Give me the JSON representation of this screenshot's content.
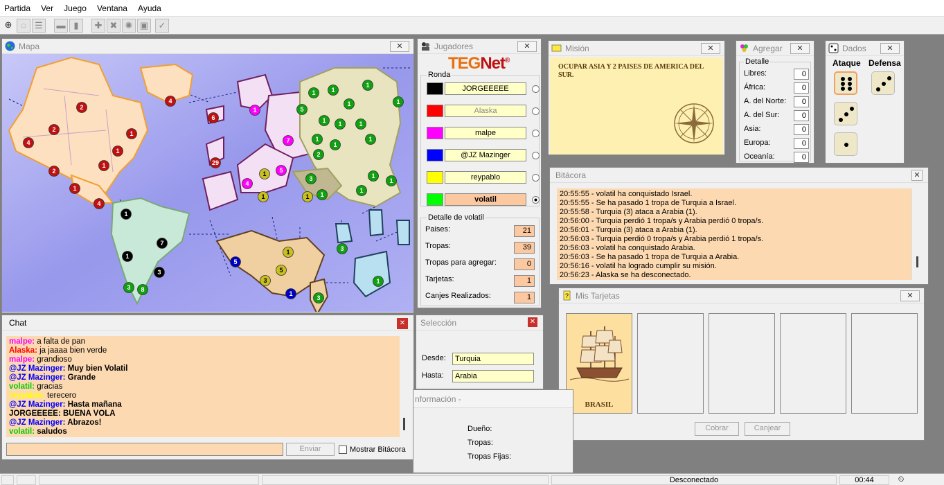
{
  "menu": [
    "Partida",
    "Ver",
    "Juego",
    "Ventana",
    "Ayuda"
  ],
  "map_window": {
    "title": "Mapa"
  },
  "map_armies": [
    {
      "c": "#ffffff",
      "n": "2"
    },
    {
      "c": "#ffffff",
      "n": "2"
    },
    {
      "c": "#ffffff",
      "n": "4"
    },
    {
      "c": "#ffffff",
      "n": "1"
    },
    {
      "c": "#ffffff",
      "n": "4"
    },
    {
      "c": "#ffffff",
      "n": "2"
    },
    {
      "c": "#ffffff",
      "n": "1"
    },
    {
      "c": "#ffffff",
      "n": "1"
    },
    {
      "c": "#ffffff",
      "n": "1"
    },
    {
      "c": "#ffffff",
      "n": "4"
    },
    {
      "c": "#ffffff",
      "n": "6"
    },
    {
      "c": "#ffffff",
      "n": "29"
    },
    {
      "c": "#ffffff",
      "n": "1"
    },
    {
      "c": "#ffffff",
      "n": "7"
    },
    {
      "c": "#ffffff",
      "n": "5"
    },
    {
      "c": "#ffffff",
      "n": "4"
    },
    {
      "c": "#ffffff",
      "n": "1"
    },
    {
      "c": "#ffffff",
      "n": "1"
    },
    {
      "c": "#ffffff",
      "n": "1"
    },
    {
      "c": "#ffffff",
      "n": "1"
    },
    {
      "c": "#ffffff",
      "n": "1"
    },
    {
      "c": "#ffffff",
      "n": "1"
    },
    {
      "c": "#ffffff",
      "n": "1"
    },
    {
      "c": "#ffffff",
      "n": "5"
    },
    {
      "c": "#ffffff",
      "n": "1"
    },
    {
      "c": "#ffffff",
      "n": "1"
    },
    {
      "c": "#ffffff",
      "n": "1"
    },
    {
      "c": "#ffffff",
      "n": "1"
    },
    {
      "c": "#ffffff",
      "n": "2"
    },
    {
      "c": "#ffffff",
      "n": "3"
    },
    {
      "c": "#ffffff",
      "n": "1"
    },
    {
      "c": "#ffffff",
      "n": "1"
    },
    {
      "c": "#ffffff",
      "n": "1"
    },
    {
      "c": "#ffffff",
      "n": "1"
    },
    {
      "c": "#ffffff",
      "n": "1"
    },
    {
      "c": "#ffffff",
      "n": "1"
    },
    {
      "c": "#ffffff",
      "n": "3"
    },
    {
      "c": "#ffffff",
      "n": "1"
    },
    {
      "c": "#ffffff",
      "n": "1"
    },
    {
      "c": "#ffffff",
      "n": "7"
    },
    {
      "c": "#ffffff",
      "n": "1"
    },
    {
      "c": "#ffffff",
      "n": "3"
    },
    {
      "c": "#ffffff",
      "n": "3"
    },
    {
      "c": "#ffffff",
      "n": "8"
    },
    {
      "c": "#ffffff",
      "n": "5"
    },
    {
      "c": "#ffffff",
      "n": "1"
    },
    {
      "c": "#ffffff",
      "n": "5"
    },
    {
      "c": "#ffffff",
      "n": "3"
    },
    {
      "c": "#ffffff",
      "n": "1"
    },
    {
      "c": "#ffffff",
      "n": "3"
    },
    {
      "c": "#ffffff",
      "n": "1"
    }
  ],
  "players_window": {
    "title": "Jugadores",
    "logo_a": "TEG",
    "logo_b": "Net",
    "logo_reg": "®",
    "ronda_label": "Ronda",
    "players": [
      {
        "name": "JORGEEEEE",
        "color": "#000000"
      },
      {
        "name": "Alaska",
        "color": "#ff0000"
      },
      {
        "name": "malpe",
        "color": "#ff00ff"
      },
      {
        "name": "@JZ Mazinger",
        "color": "#0000ff"
      },
      {
        "name": "reypablo",
        "color": "#ffff00"
      },
      {
        "name": "volatil",
        "color": "#00ff00"
      }
    ],
    "detalle_title": "Detalle de volatil",
    "stats": [
      {
        "label": "Paises:",
        "value": "21"
      },
      {
        "label": "Tropas:",
        "value": "39"
      },
      {
        "label": "Tropas para agregar:",
        "value": "0"
      },
      {
        "label": "Tarjetas:",
        "value": "1"
      },
      {
        "label": "Canjes Realizados:",
        "value": "1"
      }
    ]
  },
  "mission_window": {
    "title": "Misión",
    "text": "OCUPAR ASIA Y 2 PAISES DE AMERICA DEL SUR."
  },
  "agregar_window": {
    "title": "Agregar",
    "group": "Detalle",
    "rows": [
      {
        "label": "Libres:",
        "value": "0"
      },
      {
        "label": "África:",
        "value": "0"
      },
      {
        "label": "A. del Norte:",
        "value": "0"
      },
      {
        "label": "A. del Sur:",
        "value": "0"
      },
      {
        "label": "Asia:",
        "value": "0"
      },
      {
        "label": "Europa:",
        "value": "0"
      },
      {
        "label": "Oceanía:",
        "value": "0"
      }
    ]
  },
  "dados_window": {
    "title": "Dados",
    "ataque": "Ataque",
    "defensa": "Defensa"
  },
  "bitacora_window": {
    "title": "Bitácora",
    "lines": [
      "20:55:55 - volatil ha conquistado Israel.",
      "20:55:55 - Se ha pasado 1 tropa de Turquia a Israel.",
      "20:55:58 - Turquia (3) ataca a Arabia (1).",
      "20:56:00 - Turquia perdió 1 tropa/s y Arabia perdió 0 tropa/s.",
      "20:56:01 - Turquia (3) ataca a Arabia (1).",
      "20:56:03 - Turquia perdió 0 tropa/s y Arabia perdió 1 tropa/s.",
      "20:56:03 - volatil ha conquistado Arabia.",
      "20:56:03 - Se ha pasado 1 tropa de Turquia a Arabia.",
      "20:56:16 - volatil ha logrado cumplir su misión.",
      "20:56:23 - Alaska se ha desconectado."
    ]
  },
  "tarjetas_window": {
    "title": "Mis Tarjetas",
    "card_name": "BRASIL",
    "cobrar": "Cobrar",
    "canjear": "Canjear"
  },
  "chat_window": {
    "title": "Chat",
    "lines": [
      {
        "user": "malpe:",
        "color": "#ff00ff",
        "msg": "a falta de pan"
      },
      {
        "user": "Alaska:",
        "color": "#ff0000",
        "msg": "ja jaaaa bien verde"
      },
      {
        "user": "malpe:",
        "color": "#ff00ff",
        "msg": "grandioso"
      },
      {
        "user": "@JZ Mazinger:",
        "color": "#0000ff",
        "msg": "Muy bien Volatil"
      },
      {
        "user": "@JZ Mazinger:",
        "color": "#0000ff",
        "msg": "Grande"
      },
      {
        "user": "volatil:",
        "color": "#00cc00",
        "msg": "gracias"
      },
      {
        "user": "reypablo:",
        "color": "#ffff00",
        "msg": "terecero"
      },
      {
        "user": "@JZ Mazinger:",
        "color": "#0000ff",
        "msg": "Hasta mañana"
      },
      {
        "user": "JORGEEEEE:",
        "color": "#000000",
        "msg": "BUENA VOLA"
      },
      {
        "user": "@JZ Mazinger:",
        "color": "#0000ff",
        "msg": "Abrazos!"
      },
      {
        "user": "volatil:",
        "color": "#00cc00",
        "msg": "saludos"
      }
    ],
    "input_value": "",
    "send": "Enviar",
    "show_log": "Mostrar Bitácora"
  },
  "seleccion_window": {
    "title": "Selección",
    "desde_label": "Desde:",
    "desde": "Turquia",
    "hasta_label": "Hasta:",
    "hasta": "Arabia"
  },
  "info_window": {
    "title": "nformación -",
    "dueno": "Dueño:",
    "tropas": "Tropas:",
    "tropas_fijas": "Tropas Fijas:"
  },
  "statusbar": {
    "status": "Desconectado",
    "time": "00:44"
  }
}
